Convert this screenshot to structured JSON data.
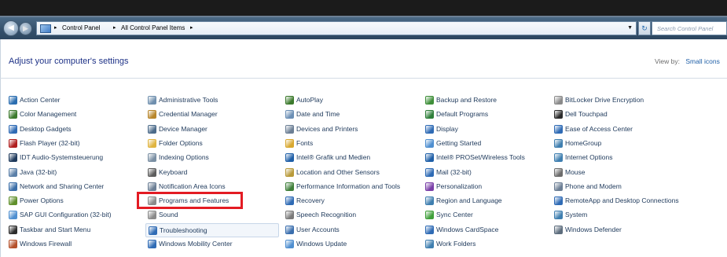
{
  "window": {
    "breadcrumbs": [
      "Control Panel",
      "All Control Panel Items"
    ],
    "search_placeholder": "Search Control Panel"
  },
  "header": {
    "title": "Adjust your computer's settings",
    "view_by_label": "View by:",
    "view_by_value": "Small icons"
  },
  "columns": [
    [
      {
        "label": "Action Center",
        "icon": "flag-icon",
        "color": "#2a6db0"
      },
      {
        "label": "Color Management",
        "icon": "monitor-color-icon",
        "color": "#3c7a2d"
      },
      {
        "label": "Desktop Gadgets",
        "icon": "gadgets-icon",
        "color": "#2f6bb5"
      },
      {
        "label": "Flash Player (32-bit)",
        "icon": "flash-icon",
        "color": "#b01f1f"
      },
      {
        "label": "IDT Audio-Systemsteuerung",
        "icon": "audio-icon",
        "color": "#1f3a5c"
      },
      {
        "label": "Java (32-bit)",
        "icon": "java-icon",
        "color": "#5a7fa8"
      },
      {
        "label": "Network and Sharing Center",
        "icon": "network-icon",
        "color": "#3a6ea8"
      },
      {
        "label": "Power Options",
        "icon": "power-icon",
        "color": "#5f8f2a"
      },
      {
        "label": "SAP GUI Configuration (32-bit)",
        "icon": "sap-icon",
        "color": "#4f8fd0"
      },
      {
        "label": "Taskbar and Start Menu",
        "icon": "taskbar-icon",
        "color": "#2c2c2c"
      },
      {
        "label": "Windows Firewall",
        "icon": "firewall-icon",
        "color": "#b5502a"
      }
    ],
    [
      {
        "label": "Administrative Tools",
        "icon": "admin-tools-icon",
        "color": "#6f8fae"
      },
      {
        "label": "Credential Manager",
        "icon": "credential-icon",
        "color": "#b8862b"
      },
      {
        "label": "Device Manager",
        "icon": "device-manager-icon",
        "color": "#4c6b8a"
      },
      {
        "label": "Folder Options",
        "icon": "folder-icon",
        "color": "#e0b440"
      },
      {
        "label": "Indexing Options",
        "icon": "indexing-icon",
        "color": "#7a8fa3"
      },
      {
        "label": "Keyboard",
        "icon": "keyboard-icon",
        "color": "#5d5d5d"
      },
      {
        "label": "Notification Area Icons",
        "icon": "notification-icon",
        "color": "#6c7f95"
      },
      {
        "label": "Programs and Features",
        "icon": "programs-icon",
        "color": "#8a8a8a"
      },
      {
        "label": "Sound",
        "icon": "sound-icon",
        "color": "#8a8a8a"
      },
      {
        "label": "Troubleshooting",
        "icon": "troubleshooting-icon",
        "color": "#2f6bb5"
      },
      {
        "label": "Windows Mobility Center",
        "icon": "mobility-icon",
        "color": "#2f6bb5"
      }
    ],
    [
      {
        "label": "AutoPlay",
        "icon": "autoplay-icon",
        "color": "#3c7a2d"
      },
      {
        "label": "Date and Time",
        "icon": "clock-icon",
        "color": "#6b8fb5"
      },
      {
        "label": "Devices and Printers",
        "icon": "printer-icon",
        "color": "#6c7f95"
      },
      {
        "label": "Fonts",
        "icon": "fonts-icon",
        "color": "#d8a830"
      },
      {
        "label": "Intel® Grafik und Medien",
        "icon": "intel-graphics-icon",
        "color": "#1f5fa7"
      },
      {
        "label": "Location and Other Sensors",
        "icon": "sensors-icon",
        "color": "#b89a3a"
      },
      {
        "label": "Performance Information and Tools",
        "icon": "performance-icon",
        "color": "#3f7f3a"
      },
      {
        "label": "Recovery",
        "icon": "recovery-icon",
        "color": "#2f6bb5"
      },
      {
        "label": "Speech Recognition",
        "icon": "microphone-icon",
        "color": "#7a7a7a"
      },
      {
        "label": "User Accounts",
        "icon": "users-icon",
        "color": "#3b6fae"
      },
      {
        "label": "Windows Update",
        "icon": "windows-update-icon",
        "color": "#4f8fd0"
      }
    ],
    [
      {
        "label": "Backup and Restore",
        "icon": "backup-icon",
        "color": "#3f8f3a"
      },
      {
        "label": "Default Programs",
        "icon": "default-programs-icon",
        "color": "#2f7f3a"
      },
      {
        "label": "Display",
        "icon": "display-icon",
        "color": "#2f6bb5"
      },
      {
        "label": "Getting Started",
        "icon": "getting-started-icon",
        "color": "#4f8fd0"
      },
      {
        "label": "Intel® PROSet/Wireless Tools",
        "icon": "wireless-icon",
        "color": "#1f5fa7"
      },
      {
        "label": "Mail (32-bit)",
        "icon": "mail-icon",
        "color": "#2f6bb5"
      },
      {
        "label": "Personalization",
        "icon": "personalization-icon",
        "color": "#7a3fa8"
      },
      {
        "label": "Region and Language",
        "icon": "globe-icon",
        "color": "#3f7fb0"
      },
      {
        "label": "Sync Center",
        "icon": "sync-icon",
        "color": "#3f9f3a"
      },
      {
        "label": "Windows CardSpace",
        "icon": "cardspace-icon",
        "color": "#2f6bb5"
      },
      {
        "label": "Work Folders",
        "icon": "work-folders-icon",
        "color": "#3f7fb0"
      }
    ],
    [
      {
        "label": "BitLocker Drive Encryption",
        "icon": "bitlocker-icon",
        "color": "#8a8a8a"
      },
      {
        "label": "Dell Touchpad",
        "icon": "touchpad-icon",
        "color": "#2c2c2c"
      },
      {
        "label": "Ease of Access Center",
        "icon": "ease-of-access-icon",
        "color": "#2f6bb5"
      },
      {
        "label": "HomeGroup",
        "icon": "homegroup-icon",
        "color": "#3f7fb0"
      },
      {
        "label": "Internet Options",
        "icon": "internet-options-icon",
        "color": "#3f7fb0"
      },
      {
        "label": "Mouse",
        "icon": "mouse-icon",
        "color": "#6c6c6c"
      },
      {
        "label": "Phone and Modem",
        "icon": "phone-modem-icon",
        "color": "#6c7f95"
      },
      {
        "label": "RemoteApp and Desktop Connections",
        "icon": "remoteapp-icon",
        "color": "#2f6bb5"
      },
      {
        "label": "System",
        "icon": "system-icon",
        "color": "#3f7fb0"
      },
      {
        "label": "Windows Defender",
        "icon": "defender-icon",
        "color": "#5d6d7d"
      }
    ]
  ]
}
